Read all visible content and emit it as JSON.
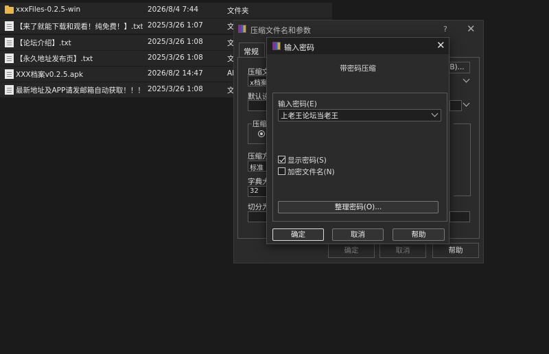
{
  "files": [
    {
      "icon": "folder-icon",
      "name": "xxxFiles-0.2.5-win",
      "date": "2026/8/4 7:44",
      "type": "文件夹"
    },
    {
      "icon": "text-file-icon",
      "name": "【来了就能下载和观看！纯免费！】.txt",
      "date": "2025/3/26 1:07",
      "type": "文"
    },
    {
      "icon": "text-file-icon",
      "name": "【论坛介绍】.txt",
      "date": "2025/3/26 1:08",
      "type": "文"
    },
    {
      "icon": "text-file-icon",
      "name": "【永久地址发布页】.txt",
      "date": "2025/3/26 1:08",
      "type": "文"
    },
    {
      "icon": "file-icon",
      "name": "XXX档案v0.2.5.apk",
      "date": "2026/8/2 14:47",
      "type": "Al"
    },
    {
      "icon": "text-file-icon",
      "name": "最新地址及APP请发邮箱自动获取！！！....",
      "date": "2025/3/26 1:08",
      "type": "文"
    }
  ],
  "archive_dialog": {
    "title": "压缩文件名和参数",
    "help_mark": "?",
    "close": "✕",
    "tab_general": "常规",
    "label_archive_name": "压缩文",
    "archive_name_value": "x档案",
    "browse_label": "B)...",
    "label_default_profile": "默认设",
    "label_format": "压缩文",
    "label_method": "压缩方",
    "method_value": "标准",
    "label_dict": "字典大",
    "dict_value": "32",
    "label_split": "切分为",
    "ok": "确定",
    "cancel": "取消",
    "help": "帮助"
  },
  "password_dialog": {
    "title": "输入密码",
    "close": "✕",
    "subtitle": "带密码压缩",
    "label_password": "输入密码(E)",
    "password_value": "上老王论坛当老王",
    "show_password_label": "显示密码(S)",
    "show_password_checked": true,
    "encrypt_names_label": "加密文件名(N)",
    "encrypt_names_checked": false,
    "organize_label": "整理密码(O)...",
    "ok": "确定",
    "cancel": "取消",
    "help": "帮助"
  },
  "colors": {
    "background": "#1b1b1b",
    "dialog": "#2b2b2b",
    "folder": "#e8b64a"
  }
}
